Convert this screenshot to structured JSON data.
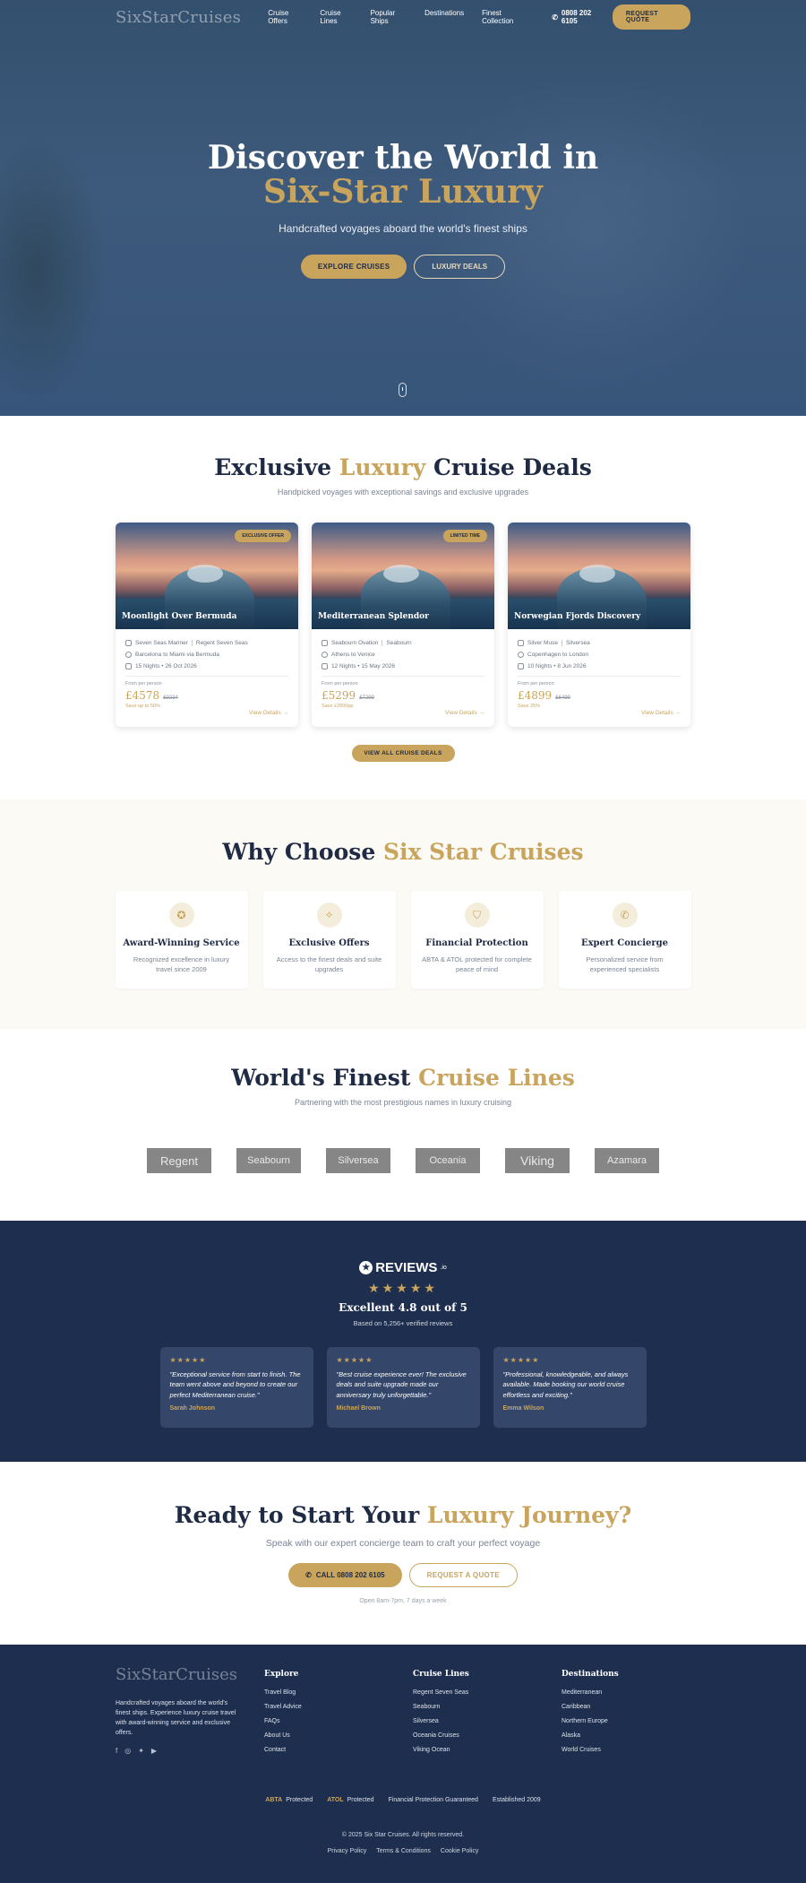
{
  "nav": {
    "logo": "SixStarCruises",
    "links": [
      "Cruise Offers",
      "Cruise Lines",
      "Popular Ships",
      "Destinations",
      "Finest Collection"
    ],
    "phone": "0808 202 6105",
    "quote_btn": "REQUEST QUOTE"
  },
  "hero": {
    "title_line1": "Discover the World in",
    "title_line2": "Six-Star Luxury",
    "subtitle": "Handcrafted voyages aboard the world's finest ships",
    "btn_primary": "EXPLORE CRUISES",
    "btn_secondary": "LUXURY DEALS"
  },
  "deals": {
    "title_a": "Exclusive ",
    "title_b": "Luxury",
    "title_c": " Cruise Deals",
    "subtitle": "Handpicked voyages with exceptional savings and exclusive upgrades",
    "from_label": "From per person",
    "view_label": "View Details →",
    "cards": [
      {
        "badge": "EXCLUSIVE OFFER",
        "name": "Moonlight Over Bermuda",
        "ship": "Seven Seas Mariner",
        "line": "Regent Seven Seas",
        "route": "Barcelona to Miami via Bermuda",
        "dates": "15 Nights • 26 Oct 2026",
        "price": "£4578",
        "old": "£9234",
        "save": "Save up to 50%"
      },
      {
        "badge": "LIMITED TIME",
        "name": "Mediterranean Splendor",
        "ship": "Seabourn Ovation",
        "line": "Seabourn",
        "route": "Athens to Venice",
        "dates": "12 Nights • 15 May 2026",
        "price": "£5299",
        "old": "£7299",
        "save": "Save £2000pp"
      },
      {
        "badge": "",
        "name": "Norwegian Fjords Discovery",
        "ship": "Silver Muse",
        "line": "Silversea",
        "route": "Copenhagen to London",
        "dates": "10 Nights • 8 Jun 2026",
        "price": "£4899",
        "old": "£6499",
        "save": "Save 25%"
      }
    ],
    "all_btn": "VIEW ALL CRUISE DEALS"
  },
  "why": {
    "title_a": "Why Choose ",
    "title_b": "Six Star Cruises",
    "items": [
      {
        "icon": "award-icon",
        "title": "Award-Winning Service",
        "text": "Recognized excellence in luxury travel since 2009"
      },
      {
        "icon": "sparkle-icon",
        "title": "Exclusive Offers",
        "text": "Access to the finest deals and suite upgrades"
      },
      {
        "icon": "shield-icon",
        "title": "Financial Protection",
        "text": "ABTA & ATOL protected for complete peace of mind"
      },
      {
        "icon": "phone-icon",
        "title": "Expert Concierge",
        "text": "Personalized service from experienced specialists"
      }
    ]
  },
  "lines": {
    "title_a": "World's Finest ",
    "title_b": "Cruise Lines",
    "subtitle": "Partnering with the most prestigious names in luxury cruising",
    "logos": [
      "Regent",
      "Seabourn",
      "Silversea",
      "Oceania",
      "Viking",
      "Azamara"
    ]
  },
  "reviews": {
    "brand": "REVIEWS",
    "brand_suffix": ".io",
    "stars": "★★★★★",
    "score": "Excellent 4.8 out of 5",
    "based": "Based on 5,256+ verified reviews",
    "items": [
      {
        "stars": "★★★★★",
        "quote": "\"Exceptional service from start to finish. The team went above and beyond to create our perfect Mediterranean cruise.\"",
        "name": "Sarah Johnson"
      },
      {
        "stars": "★★★★★",
        "quote": "\"Best cruise experience ever! The exclusive deals and suite upgrade made our anniversary truly unforgettable.\"",
        "name": "Michael Brown"
      },
      {
        "stars": "★★★★★",
        "quote": "\"Professional, knowledgeable, and always available. Made booking our world cruise effortless and exciting.\"",
        "name": "Emma Wilson"
      }
    ]
  },
  "cta": {
    "title_a": "Ready to Start Your ",
    "title_b": "Luxury Journey?",
    "subtitle": "Speak with our expert concierge team to craft your perfect voyage",
    "call_btn": "CALL 0808 202 6105",
    "quote_btn": "REQUEST A QUOTE",
    "hours": "Open 8am-7pm, 7 days a week"
  },
  "footer": {
    "logo": "SixStarCruises",
    "desc": "Handcrafted voyages aboard the world's finest ships. Experience luxury cruise travel with award-winning service and exclusive offers.",
    "cols": [
      {
        "head": "Explore",
        "items": [
          "Travel Blog",
          "Travel Advice",
          "FAQs",
          "About Us",
          "Contact"
        ]
      },
      {
        "head": "Cruise Lines",
        "items": [
          "Regent Seven Seas",
          "Seabourn",
          "Silversea",
          "Oceania Cruises",
          "Viking Ocean"
        ]
      },
      {
        "head": "Destinations",
        "items": [
          "Mediterranean",
          "Caribbean",
          "Northern Europe",
          "Alaska",
          "World Cruises"
        ]
      }
    ],
    "abta": "ABTA",
    "abta_text": "Protected",
    "atol": "ATOL",
    "atol_text": "Protected",
    "guarantee": "Financial Protection Guaranteed",
    "established": "Established 2009",
    "copyright": "© 2025 Six Star Cruises. All rights reserved.",
    "legal": [
      "Privacy Policy",
      "Terms & Conditions",
      "Cookie Policy"
    ]
  },
  "colors": {
    "navy": "#1e2e4f",
    "gold": "#c9a45c",
    "cream": "#fbfaf5"
  }
}
